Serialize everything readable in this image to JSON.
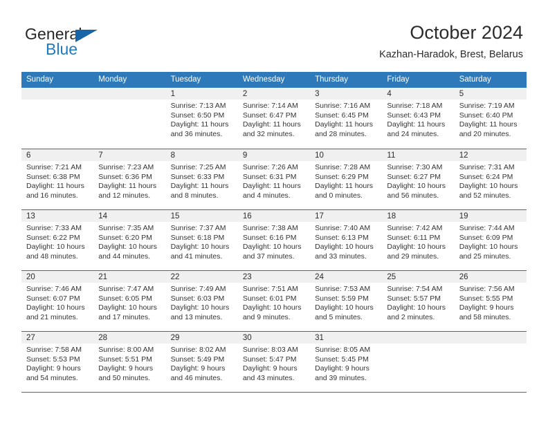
{
  "brand": {
    "name_part1": "General",
    "name_part2": "Blue",
    "logo_icon": "triangle-icon"
  },
  "header": {
    "title": "October 2024",
    "subtitle": "Kazhan-Haradok, Brest, Belarus"
  },
  "colors": {
    "header_blue": "#2e79b9",
    "rule_blue": "#2e6da4",
    "daynum_bg": "#f0f0f0",
    "brand_blue": "#1f7ac0",
    "text": "#2b2b2b"
  },
  "calendar": {
    "weekday_headers": [
      "Sunday",
      "Monday",
      "Tuesday",
      "Wednesday",
      "Thursday",
      "Friday",
      "Saturday"
    ],
    "weeks": [
      [
        {
          "day": "",
          "empty": true,
          "sunrise": "",
          "sunset": "",
          "daylight_line1": "",
          "daylight_line2": ""
        },
        {
          "day": "",
          "empty": true,
          "sunrise": "",
          "sunset": "",
          "daylight_line1": "",
          "daylight_line2": ""
        },
        {
          "day": "1",
          "empty": false,
          "sunrise": "Sunrise: 7:13 AM",
          "sunset": "Sunset: 6:50 PM",
          "daylight_line1": "Daylight: 11 hours",
          "daylight_line2": "and 36 minutes."
        },
        {
          "day": "2",
          "empty": false,
          "sunrise": "Sunrise: 7:14 AM",
          "sunset": "Sunset: 6:47 PM",
          "daylight_line1": "Daylight: 11 hours",
          "daylight_line2": "and 32 minutes."
        },
        {
          "day": "3",
          "empty": false,
          "sunrise": "Sunrise: 7:16 AM",
          "sunset": "Sunset: 6:45 PM",
          "daylight_line1": "Daylight: 11 hours",
          "daylight_line2": "and 28 minutes."
        },
        {
          "day": "4",
          "empty": false,
          "sunrise": "Sunrise: 7:18 AM",
          "sunset": "Sunset: 6:43 PM",
          "daylight_line1": "Daylight: 11 hours",
          "daylight_line2": "and 24 minutes."
        },
        {
          "day": "5",
          "empty": false,
          "sunrise": "Sunrise: 7:19 AM",
          "sunset": "Sunset: 6:40 PM",
          "daylight_line1": "Daylight: 11 hours",
          "daylight_line2": "and 20 minutes."
        }
      ],
      [
        {
          "day": "6",
          "empty": false,
          "sunrise": "Sunrise: 7:21 AM",
          "sunset": "Sunset: 6:38 PM",
          "daylight_line1": "Daylight: 11 hours",
          "daylight_line2": "and 16 minutes."
        },
        {
          "day": "7",
          "empty": false,
          "sunrise": "Sunrise: 7:23 AM",
          "sunset": "Sunset: 6:36 PM",
          "daylight_line1": "Daylight: 11 hours",
          "daylight_line2": "and 12 minutes."
        },
        {
          "day": "8",
          "empty": false,
          "sunrise": "Sunrise: 7:25 AM",
          "sunset": "Sunset: 6:33 PM",
          "daylight_line1": "Daylight: 11 hours",
          "daylight_line2": "and 8 minutes."
        },
        {
          "day": "9",
          "empty": false,
          "sunrise": "Sunrise: 7:26 AM",
          "sunset": "Sunset: 6:31 PM",
          "daylight_line1": "Daylight: 11 hours",
          "daylight_line2": "and 4 minutes."
        },
        {
          "day": "10",
          "empty": false,
          "sunrise": "Sunrise: 7:28 AM",
          "sunset": "Sunset: 6:29 PM",
          "daylight_line1": "Daylight: 11 hours",
          "daylight_line2": "and 0 minutes."
        },
        {
          "day": "11",
          "empty": false,
          "sunrise": "Sunrise: 7:30 AM",
          "sunset": "Sunset: 6:27 PM",
          "daylight_line1": "Daylight: 10 hours",
          "daylight_line2": "and 56 minutes."
        },
        {
          "day": "12",
          "empty": false,
          "sunrise": "Sunrise: 7:31 AM",
          "sunset": "Sunset: 6:24 PM",
          "daylight_line1": "Daylight: 10 hours",
          "daylight_line2": "and 52 minutes."
        }
      ],
      [
        {
          "day": "13",
          "empty": false,
          "sunrise": "Sunrise: 7:33 AM",
          "sunset": "Sunset: 6:22 PM",
          "daylight_line1": "Daylight: 10 hours",
          "daylight_line2": "and 48 minutes."
        },
        {
          "day": "14",
          "empty": false,
          "sunrise": "Sunrise: 7:35 AM",
          "sunset": "Sunset: 6:20 PM",
          "daylight_line1": "Daylight: 10 hours",
          "daylight_line2": "and 44 minutes."
        },
        {
          "day": "15",
          "empty": false,
          "sunrise": "Sunrise: 7:37 AM",
          "sunset": "Sunset: 6:18 PM",
          "daylight_line1": "Daylight: 10 hours",
          "daylight_line2": "and 41 minutes."
        },
        {
          "day": "16",
          "empty": false,
          "sunrise": "Sunrise: 7:38 AM",
          "sunset": "Sunset: 6:16 PM",
          "daylight_line1": "Daylight: 10 hours",
          "daylight_line2": "and 37 minutes."
        },
        {
          "day": "17",
          "empty": false,
          "sunrise": "Sunrise: 7:40 AM",
          "sunset": "Sunset: 6:13 PM",
          "daylight_line1": "Daylight: 10 hours",
          "daylight_line2": "and 33 minutes."
        },
        {
          "day": "18",
          "empty": false,
          "sunrise": "Sunrise: 7:42 AM",
          "sunset": "Sunset: 6:11 PM",
          "daylight_line1": "Daylight: 10 hours",
          "daylight_line2": "and 29 minutes."
        },
        {
          "day": "19",
          "empty": false,
          "sunrise": "Sunrise: 7:44 AM",
          "sunset": "Sunset: 6:09 PM",
          "daylight_line1": "Daylight: 10 hours",
          "daylight_line2": "and 25 minutes."
        }
      ],
      [
        {
          "day": "20",
          "empty": false,
          "sunrise": "Sunrise: 7:46 AM",
          "sunset": "Sunset: 6:07 PM",
          "daylight_line1": "Daylight: 10 hours",
          "daylight_line2": "and 21 minutes."
        },
        {
          "day": "21",
          "empty": false,
          "sunrise": "Sunrise: 7:47 AM",
          "sunset": "Sunset: 6:05 PM",
          "daylight_line1": "Daylight: 10 hours",
          "daylight_line2": "and 17 minutes."
        },
        {
          "day": "22",
          "empty": false,
          "sunrise": "Sunrise: 7:49 AM",
          "sunset": "Sunset: 6:03 PM",
          "daylight_line1": "Daylight: 10 hours",
          "daylight_line2": "and 13 minutes."
        },
        {
          "day": "23",
          "empty": false,
          "sunrise": "Sunrise: 7:51 AM",
          "sunset": "Sunset: 6:01 PM",
          "daylight_line1": "Daylight: 10 hours",
          "daylight_line2": "and 9 minutes."
        },
        {
          "day": "24",
          "empty": false,
          "sunrise": "Sunrise: 7:53 AM",
          "sunset": "Sunset: 5:59 PM",
          "daylight_line1": "Daylight: 10 hours",
          "daylight_line2": "and 5 minutes."
        },
        {
          "day": "25",
          "empty": false,
          "sunrise": "Sunrise: 7:54 AM",
          "sunset": "Sunset: 5:57 PM",
          "daylight_line1": "Daylight: 10 hours",
          "daylight_line2": "and 2 minutes."
        },
        {
          "day": "26",
          "empty": false,
          "sunrise": "Sunrise: 7:56 AM",
          "sunset": "Sunset: 5:55 PM",
          "daylight_line1": "Daylight: 9 hours",
          "daylight_line2": "and 58 minutes."
        }
      ],
      [
        {
          "day": "27",
          "empty": false,
          "sunrise": "Sunrise: 7:58 AM",
          "sunset": "Sunset: 5:53 PM",
          "daylight_line1": "Daylight: 9 hours",
          "daylight_line2": "and 54 minutes."
        },
        {
          "day": "28",
          "empty": false,
          "sunrise": "Sunrise: 8:00 AM",
          "sunset": "Sunset: 5:51 PM",
          "daylight_line1": "Daylight: 9 hours",
          "daylight_line2": "and 50 minutes."
        },
        {
          "day": "29",
          "empty": false,
          "sunrise": "Sunrise: 8:02 AM",
          "sunset": "Sunset: 5:49 PM",
          "daylight_line1": "Daylight: 9 hours",
          "daylight_line2": "and 46 minutes."
        },
        {
          "day": "30",
          "empty": false,
          "sunrise": "Sunrise: 8:03 AM",
          "sunset": "Sunset: 5:47 PM",
          "daylight_line1": "Daylight: 9 hours",
          "daylight_line2": "and 43 minutes."
        },
        {
          "day": "31",
          "empty": false,
          "sunrise": "Sunrise: 8:05 AM",
          "sunset": "Sunset: 5:45 PM",
          "daylight_line1": "Daylight: 9 hours",
          "daylight_line2": "and 39 minutes."
        },
        {
          "day": "",
          "empty": true,
          "sunrise": "",
          "sunset": "",
          "daylight_line1": "",
          "daylight_line2": ""
        },
        {
          "day": "",
          "empty": true,
          "sunrise": "",
          "sunset": "",
          "daylight_line1": "",
          "daylight_line2": ""
        }
      ]
    ]
  }
}
